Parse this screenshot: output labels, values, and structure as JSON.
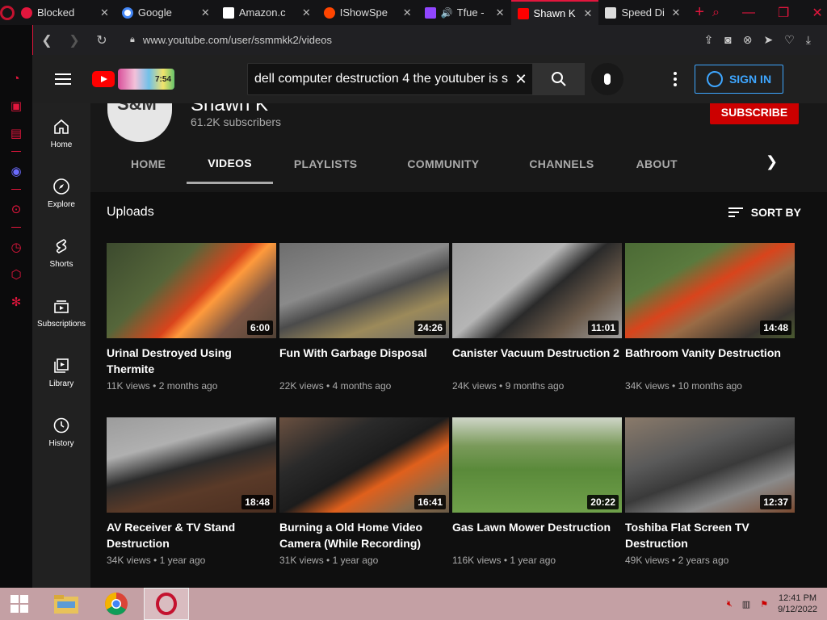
{
  "browser": {
    "tabs": [
      {
        "title": "Blocked",
        "color": "#e3163d"
      },
      {
        "title": "Google",
        "color": "#ffffff"
      },
      {
        "title": "Amazon.c",
        "color": "#ffffff"
      },
      {
        "title": "IShowSpe",
        "color": "#ff4500"
      },
      {
        "title": "Tfue -",
        "color": "#9146ff"
      },
      {
        "title": "Shawn K",
        "color": "#ff0000"
      },
      {
        "title": "Speed Di",
        "color": "#dddddd"
      }
    ],
    "url": "www.youtube.com/user/ssmmkk2/videos"
  },
  "youtube": {
    "doodle_text": "7:54",
    "search_query": "dell computer destruction 4 the youtuber is s",
    "sign_in": "SIGN IN",
    "guide": [
      "Home",
      "Explore",
      "Shorts",
      "Subscriptions",
      "Library",
      "History"
    ],
    "channel": {
      "name": "Shawn K",
      "subscribers": "61.2K subscribers",
      "avatar_text": "S&M",
      "subscribe": "SUBSCRIBE",
      "tabs": [
        "HOME",
        "VIDEOS",
        "PLAYLISTS",
        "COMMUNITY",
        "CHANNELS",
        "ABOUT"
      ]
    },
    "section_title": "Uploads",
    "sort_by": "SORT BY",
    "videos": [
      {
        "title": "Urinal Destroyed Using Thermite",
        "duration": "6:00",
        "views": "11K views",
        "age": "2 months ago"
      },
      {
        "title": "Fun With Garbage Disposal",
        "duration": "24:26",
        "views": "22K views",
        "age": "4 months ago"
      },
      {
        "title": "Canister Vacuum Destruction 2",
        "duration": "11:01",
        "views": "24K views",
        "age": "9 months ago"
      },
      {
        "title": "Bathroom Vanity Destruction",
        "duration": "14:48",
        "views": "34K views",
        "age": "10 months ago"
      },
      {
        "title": "AV Receiver & TV Stand Destruction",
        "duration": "18:48",
        "views": "34K views",
        "age": "1 year ago"
      },
      {
        "title": "Burning a Old Home Video Camera (While Recording)",
        "duration": "16:41",
        "views": "31K views",
        "age": "1 year ago"
      },
      {
        "title": "Gas Lawn Mower Destruction",
        "duration": "20:22",
        "views": "116K views",
        "age": "1 year ago"
      },
      {
        "title": "Toshiba Flat Screen TV Destruction",
        "duration": "12:37",
        "views": "49K views",
        "age": "2 years ago"
      }
    ]
  },
  "taskbar": {
    "time": "12:41 PM",
    "date": "9/12/2022"
  }
}
